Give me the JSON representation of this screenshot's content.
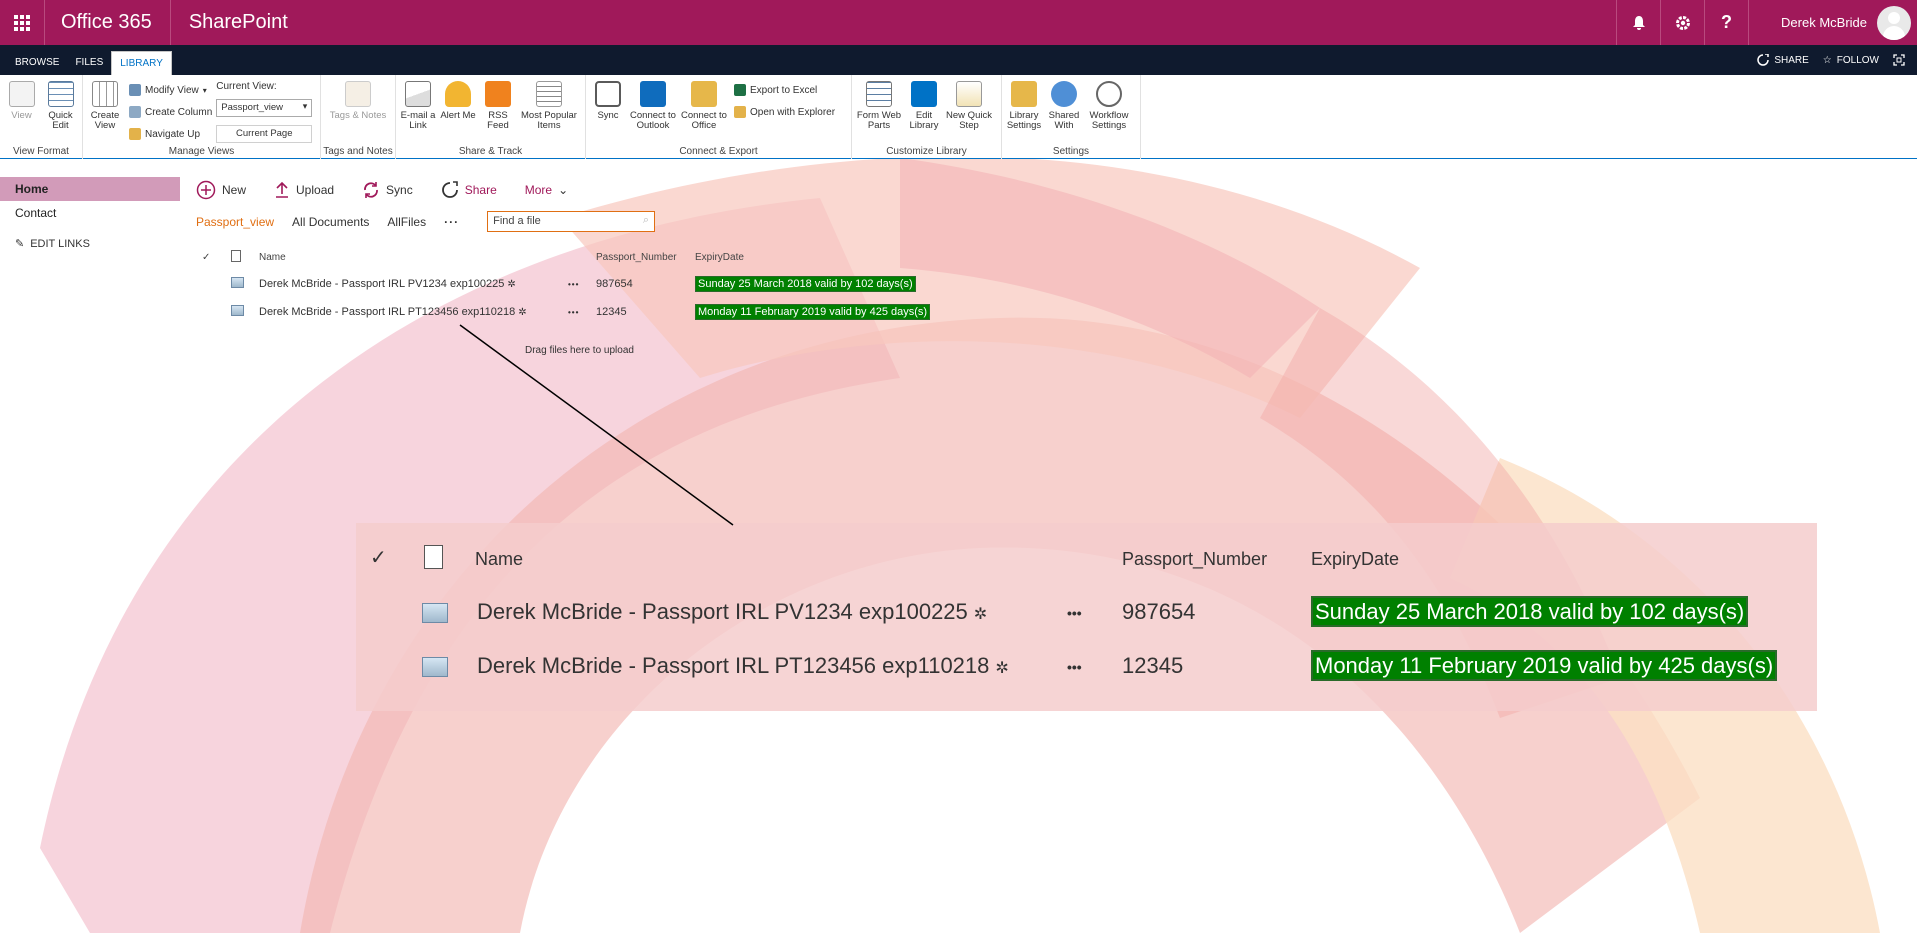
{
  "suite": {
    "brand": "Office 365",
    "app": "SharePoint",
    "user_name": "Derek McBride",
    "icons": [
      "bell-icon",
      "gear-icon",
      "help-icon"
    ],
    "help_glyph": "?"
  },
  "ribbon_tabs": {
    "browse": "BROWSE",
    "files": "FILES",
    "library": "LIBRARY",
    "share": "SHARE",
    "follow": "FOLLOW"
  },
  "ribbon": {
    "view_format": {
      "label": "View Format",
      "view": "View",
      "quick_edit": "Quick Edit"
    },
    "manage_views": {
      "label": "Manage Views",
      "create_view": "Create View",
      "modify_view": "Modify View",
      "create_column": "Create Column",
      "navigate_up": "Navigate Up",
      "current_view_label": "Current View:",
      "current_view_value": "Passport_view",
      "current_page": "Current Page"
    },
    "tags_notes": {
      "label": "Tags and Notes",
      "tags_notes": "Tags & Notes"
    },
    "share_track": {
      "label": "Share & Track",
      "email": "E-mail a Link",
      "alert": "Alert Me",
      "rss": "RSS Feed",
      "popular": "Most Popular Items"
    },
    "connect_export": {
      "label": "Connect & Export",
      "sync": "Sync",
      "outlook": "Connect to Outlook",
      "office": "Connect to Office",
      "excel": "Export to Excel",
      "explorer": "Open with Explorer"
    },
    "customize": {
      "label": "Customize Library",
      "form_web_parts": "Form Web Parts",
      "edit_library": "Edit Library",
      "quick_step": "New Quick Step"
    },
    "settings": {
      "label": "Settings",
      "library_settings": "Library Settings",
      "shared_with": "Shared With",
      "workflow_settings": "Workflow Settings"
    }
  },
  "nav": {
    "home": "Home",
    "contact": "Contact",
    "edit_links": "EDIT LINKS"
  },
  "commands": {
    "new": "New",
    "upload": "Upload",
    "sync": "Sync",
    "share": "Share",
    "more": "More"
  },
  "views": {
    "current": "Passport_view",
    "all_documents": "All Documents",
    "all_files": "AllFiles",
    "more": "···",
    "search_placeholder": "Find a file"
  },
  "list": {
    "headers": {
      "check": "✓",
      "name": "Name",
      "passport_number": "Passport_Number",
      "expiry_date": "ExpiryDate"
    },
    "rows": [
      {
        "name": "Derek McBride - Passport IRL PV1234 exp100225",
        "passport_number": "987654",
        "expiry": "Sunday 25 March 2018 valid by 102 days(s)"
      },
      {
        "name": "Derek McBride - Passport IRL PT123456 exp110218",
        "passport_number": "12345",
        "expiry": "Monday 11 February 2019 valid by 425 days(s)"
      }
    ],
    "drag_hint": "Drag files here to upload",
    "row_menu": "•••",
    "new_marker": "✲"
  },
  "colors": {
    "suite_bar": "#a0195a",
    "tab_bar": "#0f1a2e",
    "accent": "#0072c6",
    "expiry_green": "#008000",
    "view_orange": "#e06f13"
  }
}
